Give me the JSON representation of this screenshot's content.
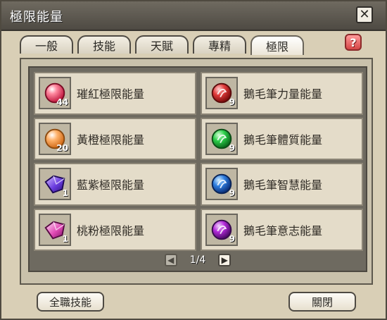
{
  "window": {
    "title": "極限能量"
  },
  "tabs": [
    {
      "label": "一般"
    },
    {
      "label": "技能"
    },
    {
      "label": "天賦"
    },
    {
      "label": "專精"
    },
    {
      "label": "極限"
    }
  ],
  "active_tab": 4,
  "items": [
    {
      "name": "璀紅極限能量",
      "count": "44",
      "icon": "red-orb-icon"
    },
    {
      "name": "鵝毛筆力量能量",
      "count": "9",
      "icon": "red-quill-orb-icon"
    },
    {
      "name": "黃橙極限能量",
      "count": "20",
      "icon": "orange-orb-icon"
    },
    {
      "name": "鵝毛筆體質能量",
      "count": "9",
      "icon": "green-quill-orb-icon"
    },
    {
      "name": "藍紫極限能量",
      "count": "1",
      "icon": "purple-gem-icon"
    },
    {
      "name": "鵝毛筆智慧能量",
      "count": "9",
      "icon": "blue-quill-orb-icon"
    },
    {
      "name": "桃粉極限能量",
      "count": "1",
      "icon": "pink-gem-icon"
    },
    {
      "name": "鵝毛筆意志能量",
      "count": "9",
      "icon": "purple-quill-orb-icon"
    }
  ],
  "pager": {
    "text": "1/4"
  },
  "buttons": {
    "skills": "全職技能",
    "close": "關閉"
  },
  "colors": {
    "titlebar": "#4e4a43",
    "panel": "#6e6a60",
    "cell": "#e4dcc9",
    "help": "#d54646"
  }
}
